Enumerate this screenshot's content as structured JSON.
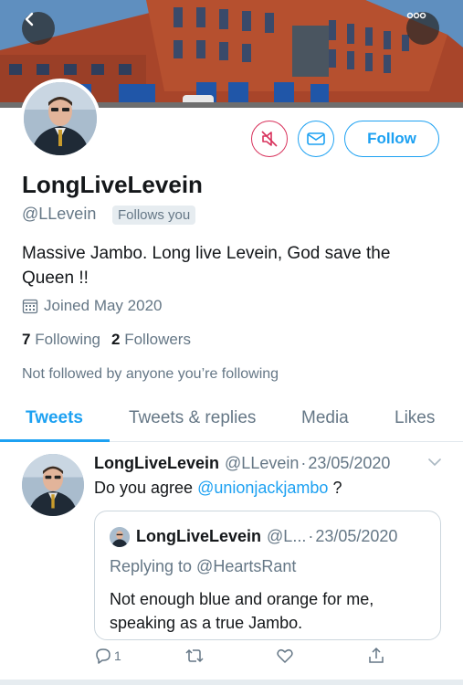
{
  "profile": {
    "display_name": "LongLiveLevein",
    "handle": "@LLevein",
    "follows_you": "Follows you",
    "bio": "Massive Jambo. Long live Levein, God save the Queen !!",
    "joined": "Joined May 2020",
    "following_count": "7",
    "following_label": "Following",
    "followers_count": "2",
    "followers_label": "Followers",
    "not_followed": "Not followed by anyone you’re following"
  },
  "buttons": {
    "follow_label": "Follow"
  },
  "tabs": [
    {
      "label": "Tweets",
      "active": true
    },
    {
      "label": "Tweets & replies",
      "active": false
    },
    {
      "label": "Media",
      "active": false
    },
    {
      "label": "Likes",
      "active": false
    }
  ],
  "tweet": {
    "name": "LongLiveLevein",
    "handle": "@LLevein",
    "separator": "·",
    "date": "23/05/2020",
    "text_prefix": "Do you agree",
    "mention": "@unionjackjambo",
    "text_suffix": "?",
    "reply_count": "1",
    "quoted": {
      "name": "LongLiveLevein",
      "handle": "@L...",
      "separator": "·",
      "date": "23/05/2020",
      "replying_to": "Replying to @HeartsRant",
      "text": "Not enough blue and orange for me, speaking as a true Jambo."
    }
  },
  "icons": {
    "back": "chevron-left-icon",
    "more": "more-dots-icon",
    "mute": "muted-speaker-icon",
    "message": "envelope-icon",
    "calendar": "calendar-icon",
    "reply": "reply-icon",
    "retweet": "retweet-icon",
    "like": "heart-icon",
    "share": "share-icon"
  },
  "colors": {
    "accent": "#1da1f2",
    "mute_red": "#d8315b",
    "text_primary": "#14171a",
    "text_secondary": "#657786"
  }
}
